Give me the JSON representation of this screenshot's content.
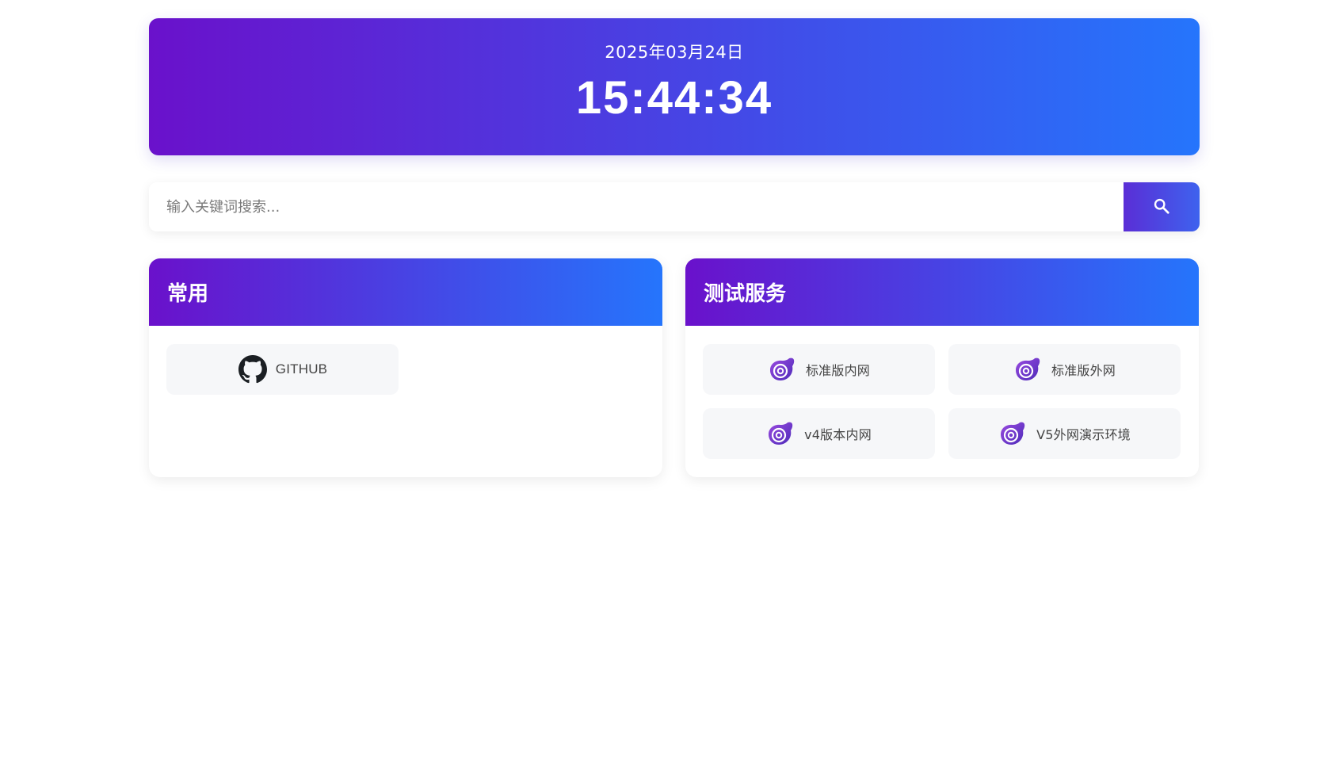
{
  "clock": {
    "date": "2025年03月24日",
    "time": "15:44:34"
  },
  "search": {
    "placeholder": "输入关键词搜索...",
    "button_icon": "search-icon"
  },
  "sections": [
    {
      "title": "常用",
      "links": [
        {
          "label": "GITHUB",
          "icon": "github-icon"
        }
      ]
    },
    {
      "title": "测试服务",
      "links": [
        {
          "label": "标准版内网",
          "icon": "blazor-logo-icon"
        },
        {
          "label": "标准版外网",
          "icon": "blazor-logo-icon"
        },
        {
          "label": "v4版本内网",
          "icon": "blazor-logo-icon"
        },
        {
          "label": "V5外网演示环境",
          "icon": "blazor-logo-icon"
        }
      ]
    }
  ],
  "colors": {
    "gradient_start": "#6a11cb",
    "gradient_end": "#2575fc"
  }
}
